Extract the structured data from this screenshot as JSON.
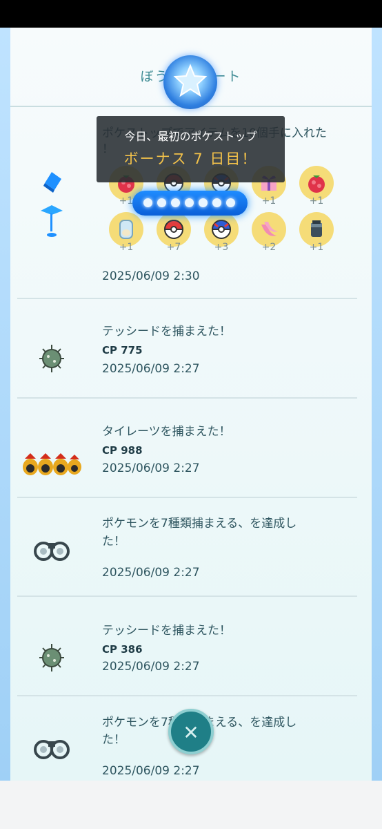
{
  "header": {
    "title": "ぼうけんノート"
  },
  "toast": {
    "line1": "今日、最初のポケストップ",
    "line2": "ボーナス 7 日目！"
  },
  "progress": {
    "days_filled": 7,
    "days_total": 7
  },
  "entries": [
    {
      "title_line1": "ポケストップでアイテムを10個手に入れた",
      "title_line2": "！",
      "date": "2025/06/09 2:30",
      "items": [
        {
          "icon": "razz-berry-icon",
          "count": "+1"
        },
        {
          "icon": "poke-ball-icon",
          "count": "+1"
        },
        {
          "icon": "great-ball-icon",
          "count": "+1"
        },
        {
          "icon": "gift-icon",
          "count": "+1"
        },
        {
          "icon": "razz-berry-icon",
          "count": "+1"
        },
        {
          "icon": "incubator-icon",
          "count": "+1"
        },
        {
          "icon": "poke-ball-icon",
          "count": "+7"
        },
        {
          "icon": "great-ball-icon",
          "count": "+3"
        },
        {
          "icon": "nanab-berry-icon",
          "count": "+2"
        },
        {
          "icon": "potion-icon",
          "count": "+1"
        }
      ]
    },
    {
      "title": "テッシードを捕まえた！",
      "cp": "CP 775",
      "date": "2025/06/09 2:27"
    },
    {
      "title": "タイレーツを捕まえた！",
      "cp": "CP 988",
      "date": "2025/06/09 2:27"
    },
    {
      "title_line1": "ポケモンを7種類捕まえる、を達成し",
      "title_line2": "た！",
      "date": "2025/06/09 2:27"
    },
    {
      "title": "テッシードを捕まえた！",
      "cp": "CP 386",
      "date": "2025/06/09 2:27"
    },
    {
      "title_line1": "ポケモンを7種類捕まえる、を達成し",
      "title_line2": "た！",
      "date": "2025/06/09 2:27"
    }
  ],
  "colors": {
    "accent": "#3d8a93",
    "text": "#2f5660",
    "toast_highlight": "#f3c24a",
    "item_bg": "#f5dc78"
  }
}
